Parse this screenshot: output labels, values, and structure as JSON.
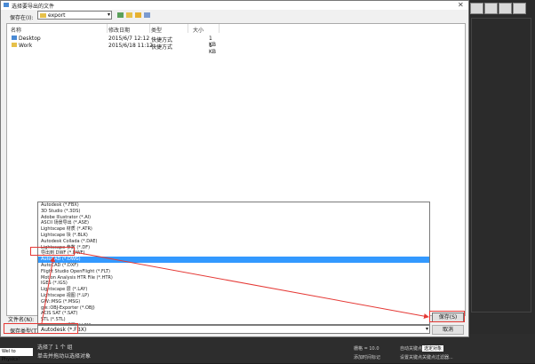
{
  "dialog": {
    "title": "选择要导出的文件",
    "save_in_label": "保存在(I):",
    "current_folder": "export",
    "columns": [
      "名称",
      "修改日期",
      "类型",
      "大小"
    ],
    "files": [
      {
        "name": "Desktop",
        "date": "2015/6/7 12:12",
        "type": "快捷方式",
        "size": "1 KB"
      },
      {
        "name": "Work",
        "date": "2015/6/18 11:12",
        "type": "快捷方式",
        "size": "1 KB"
      }
    ],
    "filename_label": "文件名(N):",
    "filetype_label": "保存类型(T):",
    "filetype_value": "Autodesk (*.FBX)",
    "save_button": "保存(S)",
    "cancel_button": "取消",
    "file_types": [
      "Autodesk (*.FBX)",
      "3D Studio (*.3DS)",
      "Adobe Illustrator (*.AI)",
      "ASCII 场景导出 (*.ASE)",
      "Lightscape 材质 (*.ATR)",
      "Lightscape 块 (*.BLK)",
      "Autodesk Collada (*.DAE)",
      "Lightscape 参数 (*.DF)",
      "导出到 DWF (*.DWF)",
      "AutoCAD (*.DWG)",
      "AutoCAD (*.DXF)",
      "Flight Studio OpenFlight (*.FLT)",
      "Motion Analysis HTR File (*.HTR)",
      "IGES (*.IGS)",
      "Lightscape 层 (*.LAY)",
      "Lightscape 视图 (*.LP)",
      "GW::MSG (*.MSG)",
      "gw::OBJ-Exporter (*.OBJ)",
      "ACIS SAT (*.SAT)",
      "STL (*.STL)",
      "Lightscape 视图 (*.VW)",
      "VRML97 (*.WRL)",
      "所有格式"
    ],
    "selected_index": 9
  },
  "status": {
    "selection": "选择了 1 个 组",
    "hint": "单击并拖动以选择对象",
    "welcome": "Wel to Physics!",
    "grid_label": "栅格 = 10.0",
    "time_label": "添加时间标记",
    "auto_key": "自动关键点",
    "set_key": "设置关键点",
    "selected_object": "选定对象",
    "key_filter": "关键点过滤器..."
  },
  "colors": {
    "annotation_red": "#e53935",
    "selection_blue": "#3399ff"
  }
}
